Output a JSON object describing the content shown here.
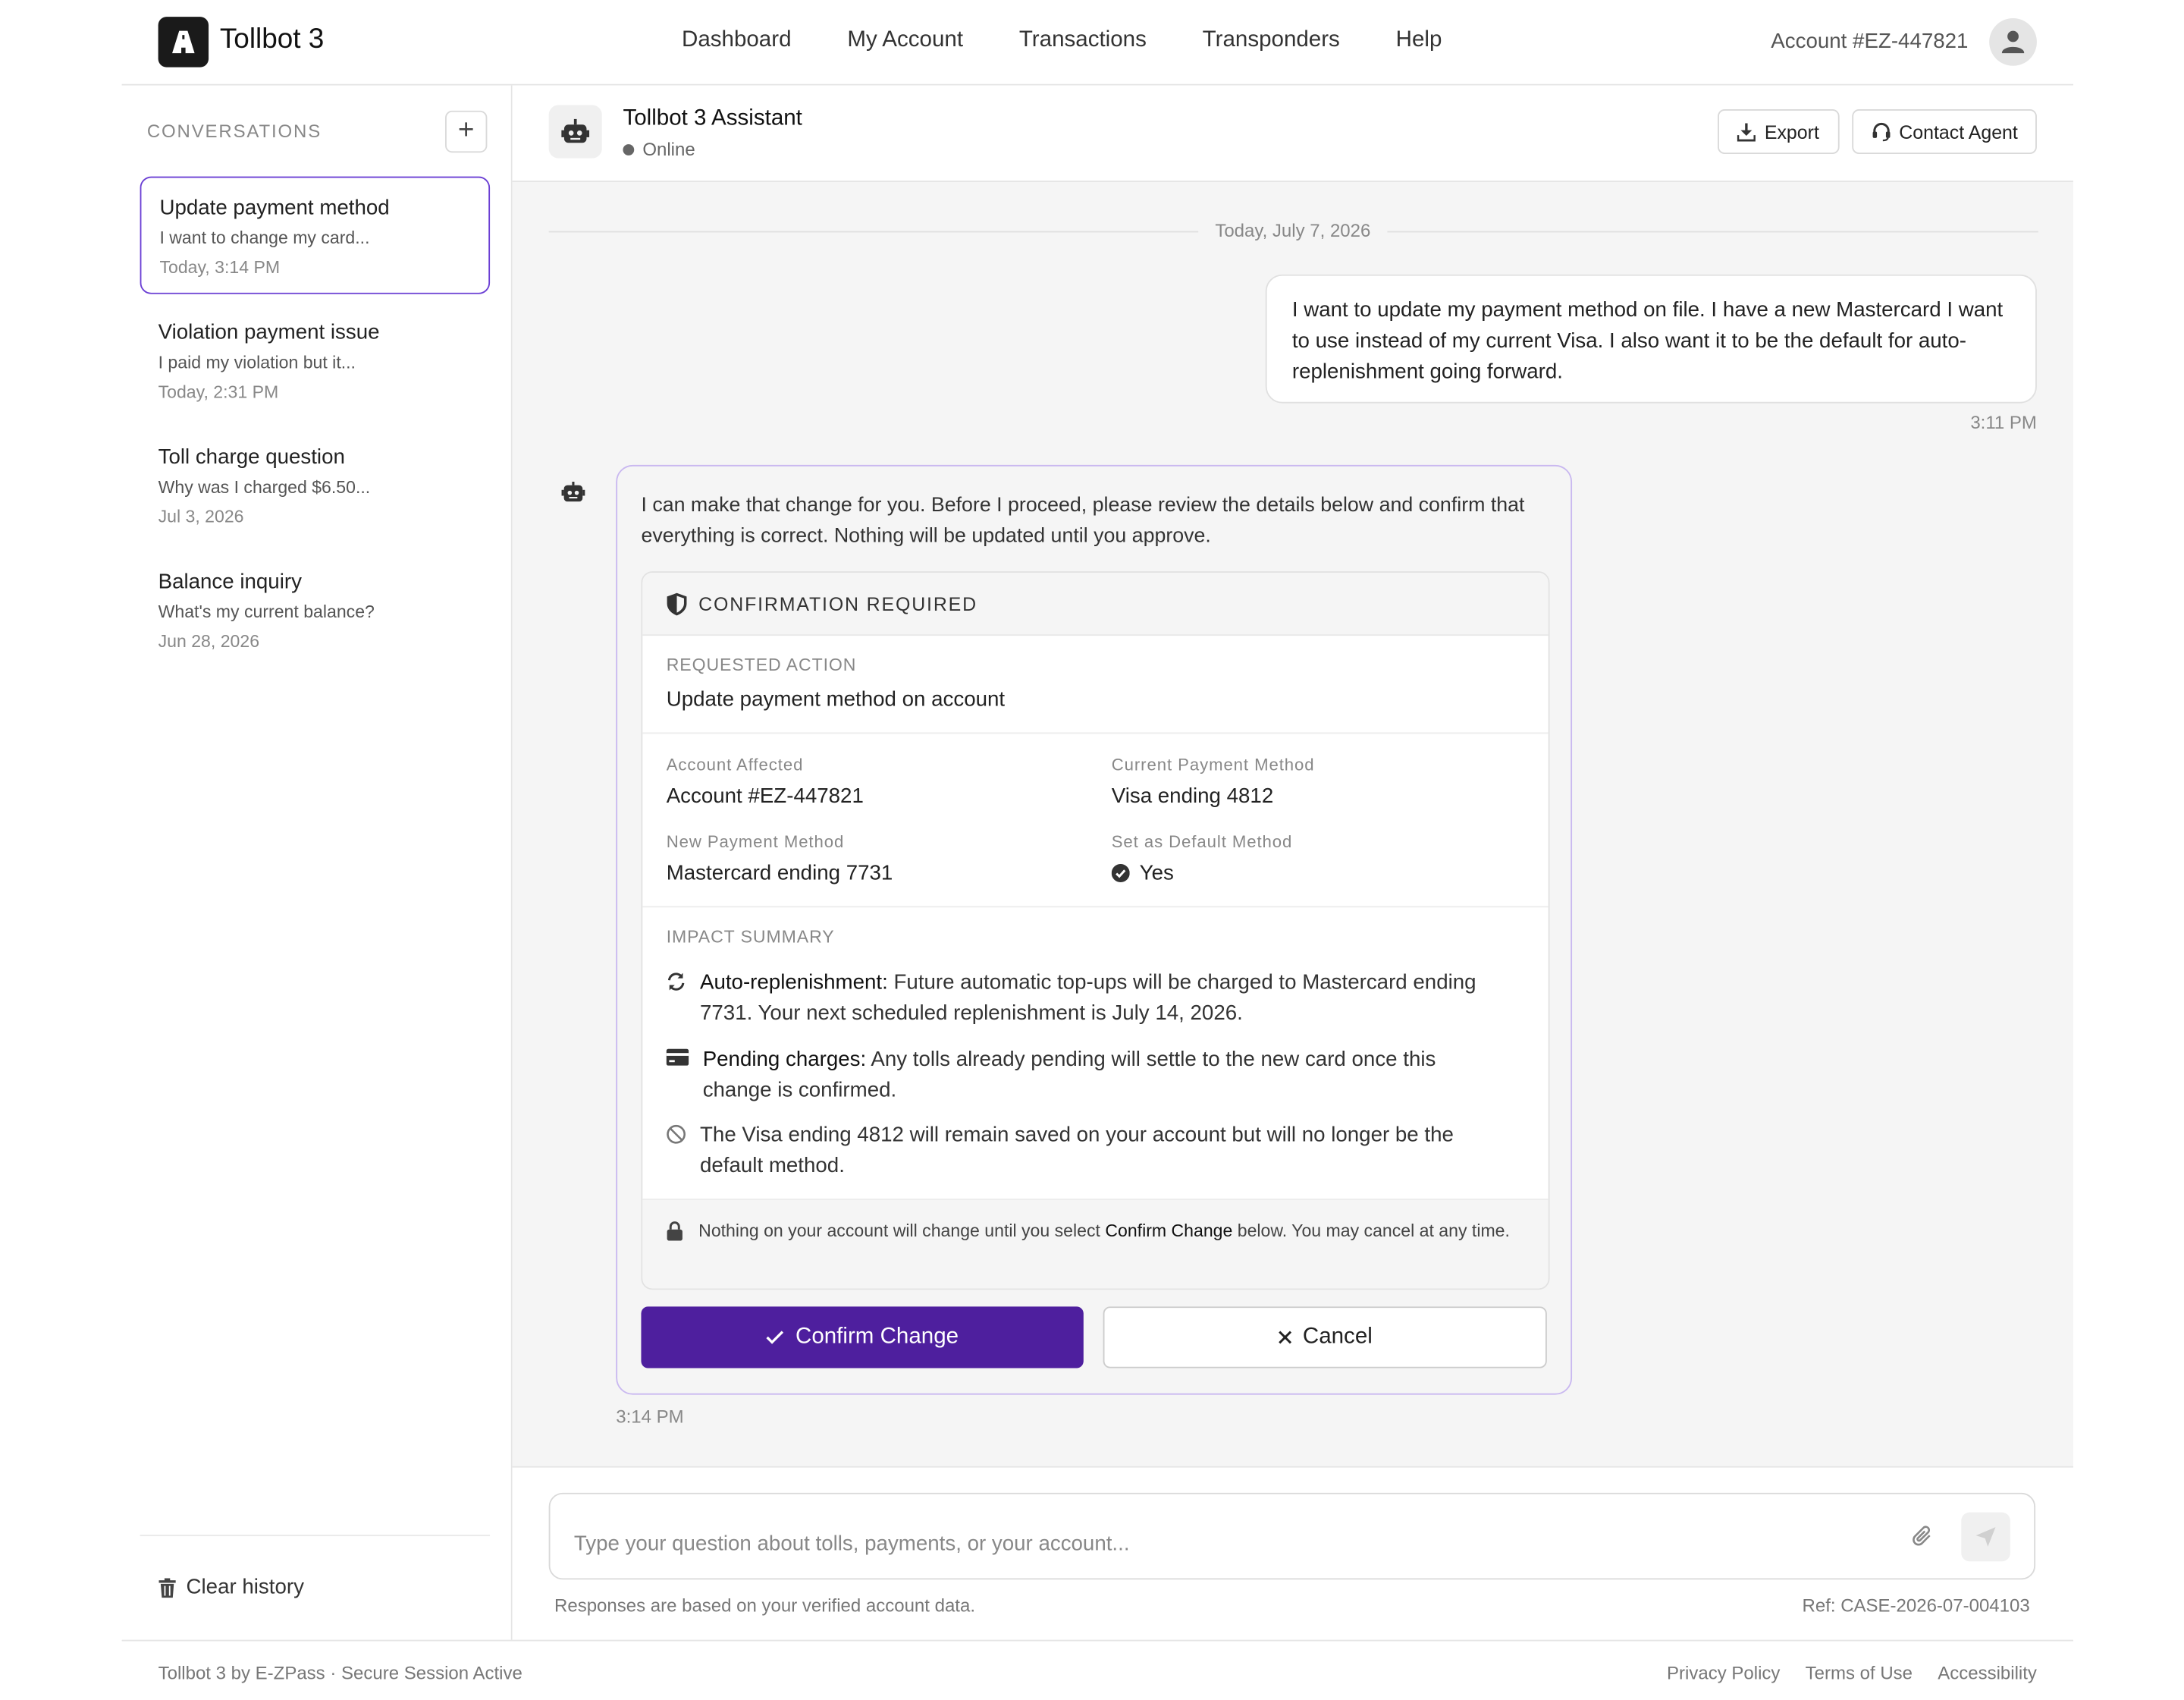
{
  "header": {
    "brand": "Tollbot 3",
    "nav": [
      "Dashboard",
      "My Account",
      "Transactions",
      "Transponders",
      "Help"
    ],
    "account": "Account #EZ-447821"
  },
  "sidebar": {
    "title": "CONVERSATIONS",
    "new_label": "+",
    "items": [
      {
        "title": "Update payment method",
        "preview": "I want to change my card...",
        "date": "Today, 3:14 PM"
      },
      {
        "title": "Violation payment issue",
        "preview": "I paid my violation but it...",
        "date": "Today, 2:31 PM"
      },
      {
        "title": "Toll charge question",
        "preview": "Why was I charged $6.50...",
        "date": "Jul 3, 2026"
      },
      {
        "title": "Balance inquiry",
        "preview": "What's my current balance?",
        "date": "Jun 28, 2026"
      }
    ],
    "clear_label": "Clear history"
  },
  "chat_header": {
    "name": "Tollbot 3 Assistant",
    "status": "Online",
    "export_label": "Export",
    "contact_label": "Contact Agent"
  },
  "chat": {
    "date": "Today, July 7, 2026",
    "user_message": "I want to update my payment method on file. I have a new Mastercard I want to use instead of my current Visa. I also want it to be the default for auto-replenishment going forward.",
    "user_time": "3:11 PM",
    "bot_intro": "I can make that change for you. Before I proceed, please review the details below and confirm that everything is correct. Nothing will be updated until you approve.",
    "bot_time": "3:14 PM"
  },
  "confirmation": {
    "header": "CONFIRMATION REQUIRED",
    "requested_action_label": "REQUESTED ACTION",
    "requested_action": "Update payment method on account",
    "account_affected_label": "Account Affected",
    "account_affected": "Account #EZ-447821",
    "current_method_label": "Current Payment Method",
    "current_method": "Visa ending 4812",
    "new_method_label": "New Payment Method",
    "new_method": "Mastercard ending 7731",
    "default_label": "Set as Default Method",
    "default_value": "Yes",
    "impact_label": "IMPACT SUMMARY",
    "impact": [
      {
        "bold": "Auto-replenishment:",
        "text": " Future automatic top-ups will be charged to Mastercard ending 7731. Your next scheduled replenishment is July 14, 2026.",
        "icon": "refresh-icon"
      },
      {
        "bold": "Pending charges:",
        "text": " Any tolls already pending will settle to the new card once this change is confirmed.",
        "icon": "credit-card-icon"
      },
      {
        "bold": "",
        "text": "The Visa ending 4812 will remain saved on your account but will no longer be the default method.",
        "icon": "ban-icon"
      }
    ],
    "footer_pre": "Nothing on your account will change until you select ",
    "footer_bold": "Confirm Change",
    "footer_post": " below. You may cancel at any time.",
    "confirm_label": "Confirm Change",
    "cancel_label": "Cancel"
  },
  "input": {
    "placeholder": "Type your question about tolls, payments, or your account...",
    "disclaimer": "Responses are based on your verified account data.",
    "ref": "Ref: CASE-2026-07-004103"
  },
  "footer": {
    "left": "Tollbot 3 by E-ZPass",
    "session": "Secure Session Active",
    "links": [
      "Privacy Policy",
      "Terms of Use",
      "Accessibility"
    ]
  },
  "colors": {
    "accent": "#4e1f9e",
    "active_border": "#6b3fd4",
    "bot_border": "#c9b8f0"
  }
}
